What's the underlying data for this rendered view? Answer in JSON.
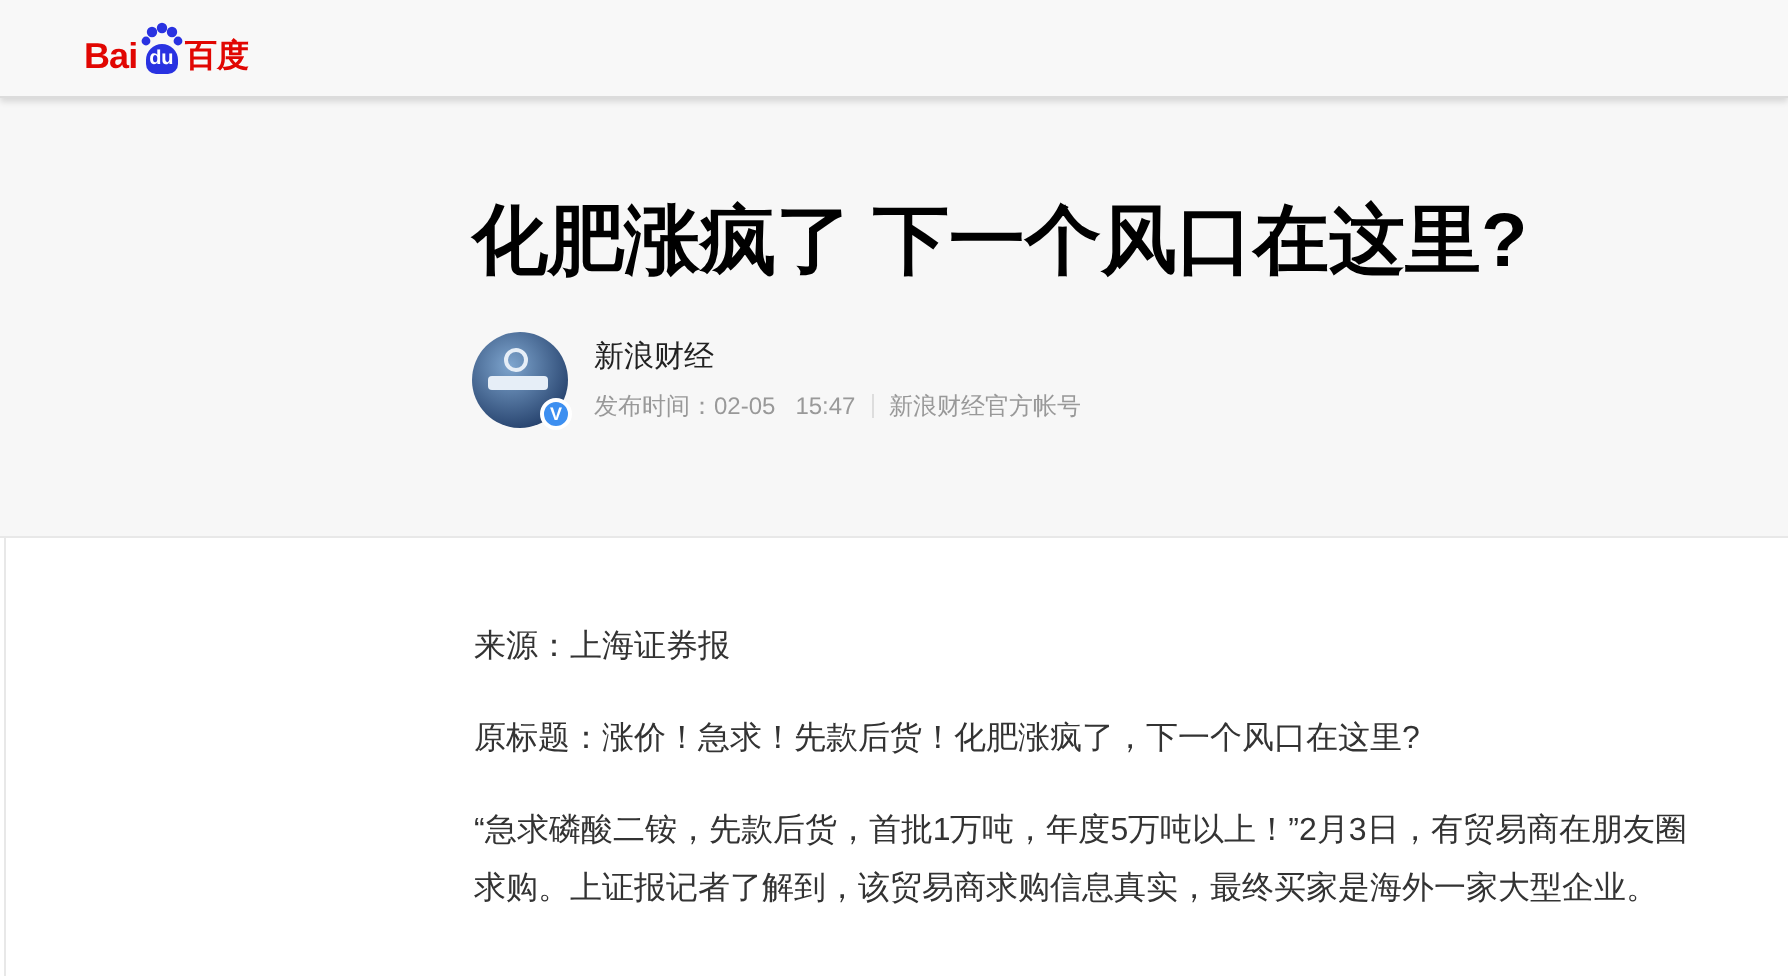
{
  "logo": {
    "left": "Bai",
    "badge": "du",
    "right": "百度"
  },
  "article": {
    "title": "化肥涨疯了 下一个风口在这里?",
    "author": {
      "name": "新浪财经",
      "verified_badge": "V",
      "published_label": "发布时间：02-05",
      "time": "15:47",
      "account": "新浪财经官方帐号"
    },
    "paragraphs": [
      "来源：上海证券报",
      "原标题：涨价！急求！先款后货！化肥涨疯了，下一个风口在这里?",
      "“急求磷酸二铵，先款后货，首批1万吨，年度5万吨以上！”2月3日，有贸易商在朋友圈求购。上证报记者了解到，该贸易商求购信息真实，最终买家是海外一家大型企业。"
    ]
  }
}
